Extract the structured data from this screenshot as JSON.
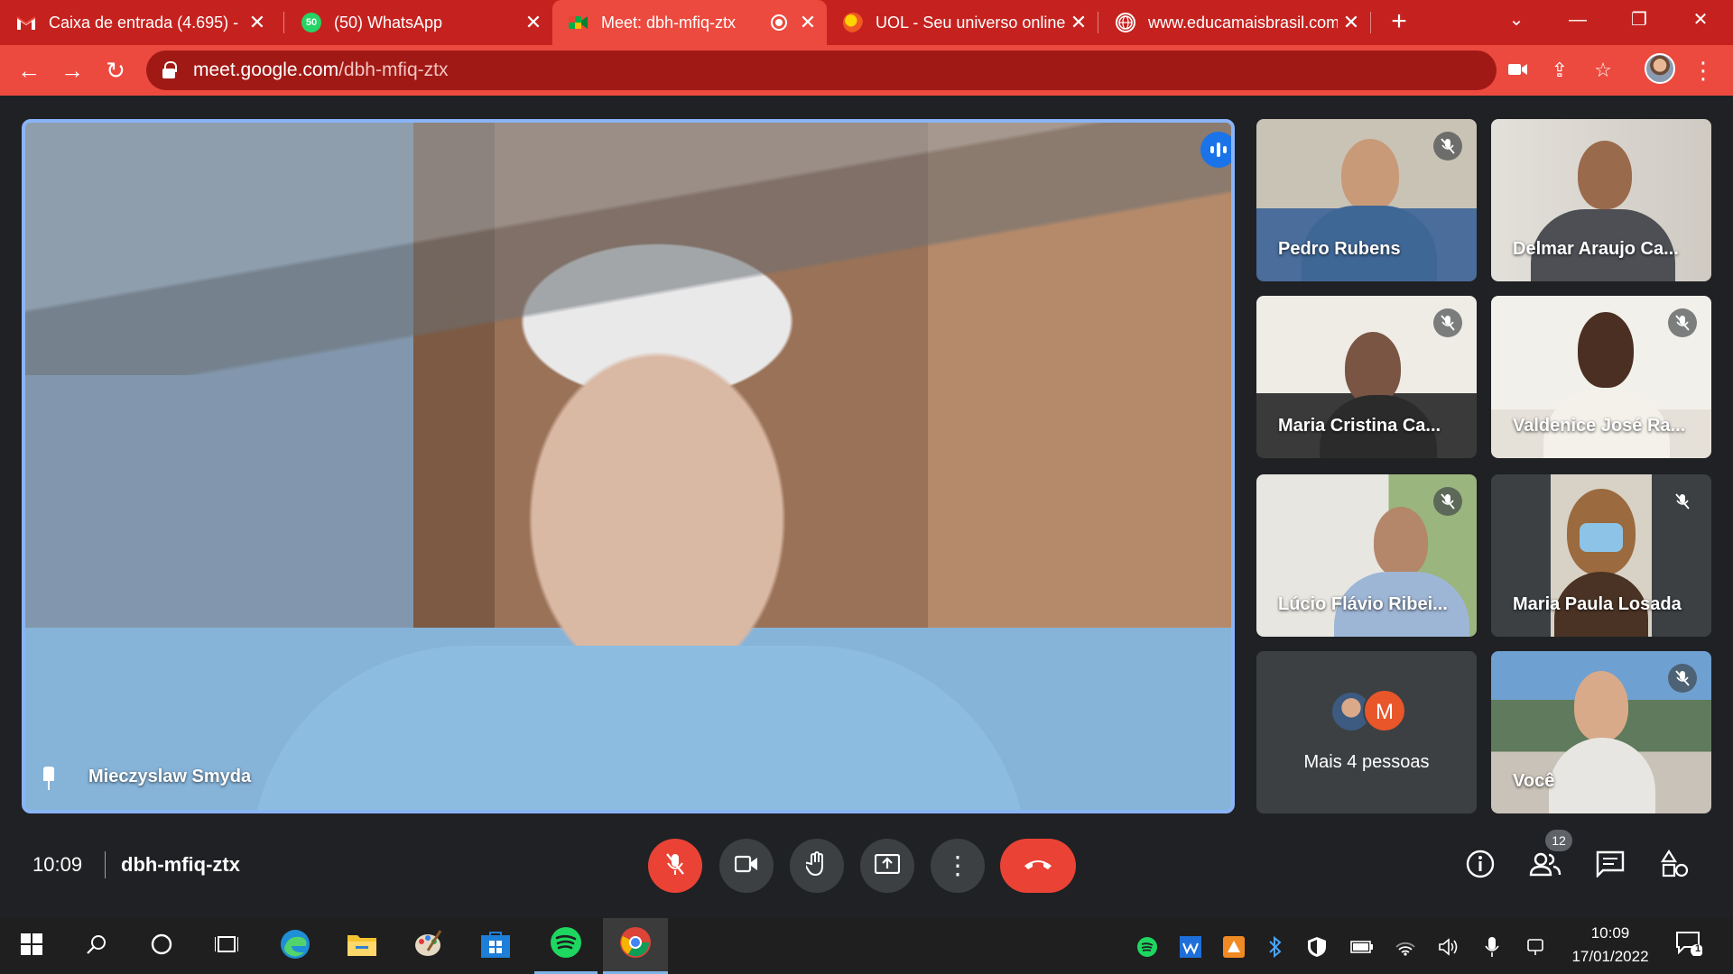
{
  "browser": {
    "tabs": [
      {
        "title": "Caixa de entrada (4.695) -",
        "icon": "gmail-icon",
        "active": false
      },
      {
        "title": "(50) WhatsApp",
        "icon": "whatsapp-icon",
        "active": false
      },
      {
        "title": "Meet: dbh-mfiq-ztx",
        "icon": "meet-icon",
        "active": true
      },
      {
        "title": "UOL - Seu universo online",
        "icon": "uol-icon",
        "active": false
      },
      {
        "title": "www.educamaisbrasil.com",
        "icon": "globe-icon",
        "active": false
      }
    ],
    "whatsapp_count": "50",
    "url_host": "meet.google.com",
    "url_path": "/dbh-mfiq-ztx",
    "theme_color": "#c5221f"
  },
  "meet": {
    "main_speaker": "Mieczyslaw Smyda",
    "participants": [
      {
        "name": "Pedro Rubens",
        "muted": true
      },
      {
        "name": "Delmar Araujo Ca...",
        "muted": false
      },
      {
        "name": "Maria Cristina Ca...",
        "muted": true
      },
      {
        "name": "Valdenice José Ra...",
        "muted": true
      },
      {
        "name": "Lúcio Flávio Ribei...",
        "muted": true
      },
      {
        "name": "Maria Paula Losada",
        "muted": true
      }
    ],
    "more_people": "Mais 4 pessoas",
    "more_avatar_letter": "M",
    "self_name": "Você",
    "time": "10:09",
    "meeting_code": "dbh-mfiq-ztx",
    "participant_count": "12",
    "accent": "#8ab4f8",
    "danger": "#ea4335"
  },
  "taskbar": {
    "time": "10:09",
    "date": "17/01/2022",
    "notification_count": "1"
  }
}
